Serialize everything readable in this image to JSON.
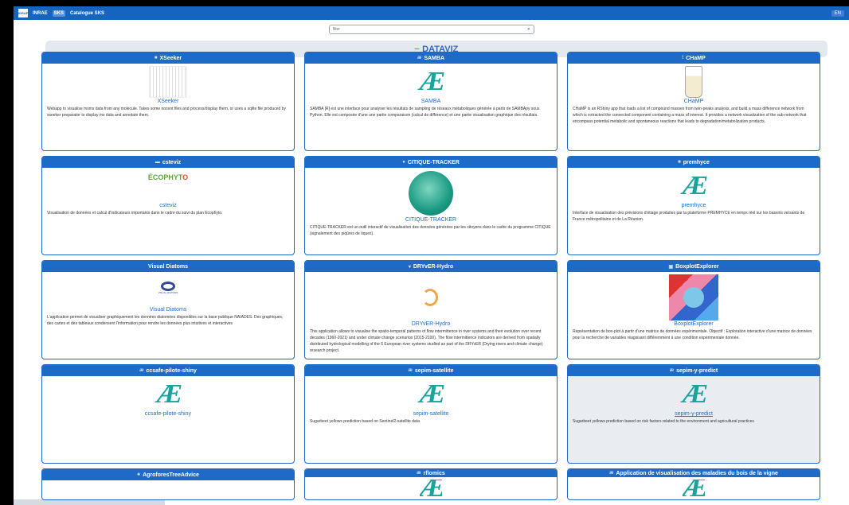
{
  "topbar": {
    "logo": "IGRAF",
    "org": "INRAE",
    "badge": "SKS",
    "catalog": "Catalogue SKS",
    "lang": "EN"
  },
  "search": {
    "placeholder": "filter"
  },
  "section": {
    "title": "DATAVIZ"
  },
  "cards": [
    {
      "title": "XSeeker",
      "name": "XSeeker",
      "desc": "Webapp to visualise msms data from any molecule. Takes some nocent files and process/display them, or uses a sqlite file produced by xseeker preparator to display ms data and annotate them."
    },
    {
      "title": "SAMBA",
      "name": "SAMBA",
      "desc": "SAMBA [R] est une interface pour analyser les résultats de sampling de réseaux métaboliques générée à partir de SAMBApy sous Python. Elle est composée d'une une partie comparaison (calcul de différence) et une partie visualisation graphique des résultats."
    },
    {
      "title": "CHaMP",
      "name": "CHaMP",
      "desc": "CHaMP is an RShiny app that loads a list of compound masses from twin-peaks analysis, and build a mass difference network from which is extracted the connected component containing a mass of interest. It provides a network visualization of the sub-network that encompass potential metabolic and spontaneous reactions that leads to degradation/metabolization products."
    },
    {
      "title": "csteviz",
      "name": "csteviz",
      "desc": "Visualisation de données et calcul d'indicateurs importants dans le cadre du suivi du plan Ecophyto."
    },
    {
      "title": "CITIQUE-TRACKER",
      "name": "CITIQUE-TRACKER",
      "desc": "CITIQUE-TRACKER est un outil interactif de visualisation des données générées par les citoyens dans le cadre du programme CITIQUE (signalement des piqûres de tiques)."
    },
    {
      "title": "premhyce",
      "name": "premhyce",
      "desc": "Interface de visualisation des prévisions d'étiage produites par la plateforme PREMHYCE en temps réel sur les bassins versants de France métropolitaine et de La Réunion."
    },
    {
      "title": "Visual Diatoms",
      "name": "Visual Diatoms",
      "desc": "L'application permet de visualiser graphiquement les données diatomées disponibles sur la base publique NAIADES. Des graphiques, des cartes et des tableaux condensent l'information pour rendre les données plus intuitives et interactives"
    },
    {
      "title": "DRYvER-Hydro",
      "name": "DRYvER-Hydro",
      "desc": "This application allows to visualise the spatio-temporal patterns of flow intermittence in river systems and their evolution over recent decades (1960-2021) and under climate change scenarios (2015-2100). The flow intermittence indicators are derived from spatially distributed hydrological modelling of the 6 European river systems studied as part of the DRYvER (Drying rivers and climate change) research project."
    },
    {
      "title": "BoxplotExplorer",
      "name": "BoxplotExplorer",
      "desc": "Représentation de box-plot à partir d'une matrice de données expérimentale. Objectif : Exploration interactive d'une matrice de données pour la recherche de variables réagissant différemment à une condition expérimentale donnée."
    },
    {
      "title": "ccsafe-pilote-shiny",
      "name": "ccsafe-pilote-shiny",
      "desc": ""
    },
    {
      "title": "sepim-satellite",
      "name": "sepim-satellite",
      "desc": "Sugarbeet yellows prediction based on Sentinel2-satellite data"
    },
    {
      "title": "sepim-y-predict",
      "name": "sepim-y-predict",
      "desc": "Sugarbeet yellows prediction based on risk factors related to the environment and agricultural practices"
    },
    {
      "title": "AgroforesTreeAdvice",
      "name": "",
      "desc": ""
    },
    {
      "title": "rflomics",
      "name": "",
      "desc": ""
    },
    {
      "title": "Application de visualisation des maladies du bois de la vigne",
      "name": "",
      "desc": ""
    }
  ],
  "colors": {
    "primary": "#1e6bc7",
    "ae_logo": "#1aa39b"
  }
}
